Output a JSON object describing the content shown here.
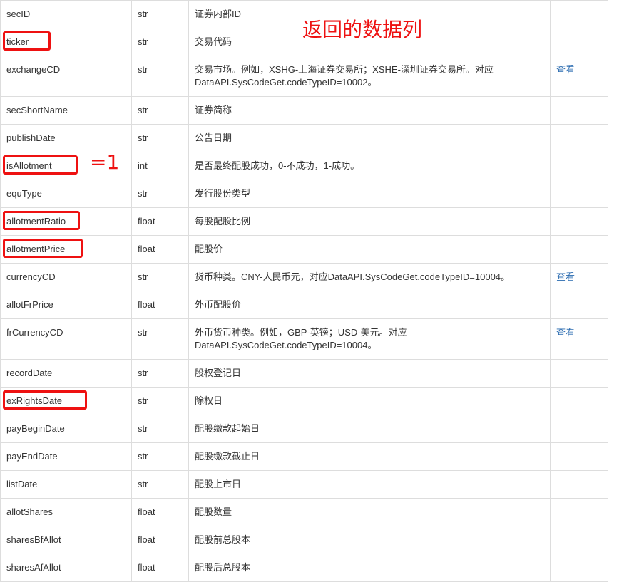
{
  "rows": [
    {
      "name": "secID",
      "type": "str",
      "desc": "证券内部ID",
      "link": "",
      "highlighted": false
    },
    {
      "name": "ticker",
      "type": "str",
      "desc": "交易代码",
      "link": "",
      "highlighted": true
    },
    {
      "name": "exchangeCD",
      "type": "str",
      "desc": "交易市场。例如，XSHG-上海证券交易所；XSHE-深圳证券交易所。对应DataAPI.SysCodeGet.codeTypeID=10002。",
      "link": "查看",
      "highlighted": false
    },
    {
      "name": "secShortName",
      "type": "str",
      "desc": "证券简称",
      "link": "",
      "highlighted": false
    },
    {
      "name": "publishDate",
      "type": "str",
      "desc": "公告日期",
      "link": "",
      "highlighted": false
    },
    {
      "name": "isAllotment",
      "type": "int",
      "desc": "是否最终配股成功，0-不成功，1-成功。",
      "link": "",
      "highlighted": true
    },
    {
      "name": "equType",
      "type": "str",
      "desc": "发行股份类型",
      "link": "",
      "highlighted": false
    },
    {
      "name": "allotmentRatio",
      "type": "float",
      "desc": "每股配股比例",
      "link": "",
      "highlighted": true
    },
    {
      "name": "allotmentPrice",
      "type": "float",
      "desc": "配股价",
      "link": "",
      "highlighted": true
    },
    {
      "name": "currencyCD",
      "type": "str",
      "desc": "货币种类。CNY-人民币元，对应DataAPI.SysCodeGet.codeTypeID=10004。",
      "link": "查看",
      "highlighted": false
    },
    {
      "name": "allotFrPrice",
      "type": "float",
      "desc": "外币配股价",
      "link": "",
      "highlighted": false
    },
    {
      "name": "frCurrencyCD",
      "type": "str",
      "desc": "外币货币种类。例如，GBP-英镑；USD-美元。对应DataAPI.SysCodeGet.codeTypeID=10004。",
      "link": "查看",
      "highlighted": false
    },
    {
      "name": "recordDate",
      "type": "str",
      "desc": "股权登记日",
      "link": "",
      "highlighted": false
    },
    {
      "name": "exRightsDate",
      "type": "str",
      "desc": "除权日",
      "link": "",
      "highlighted": true
    },
    {
      "name": "payBeginDate",
      "type": "str",
      "desc": "配股缴款起始日",
      "link": "",
      "highlighted": false
    },
    {
      "name": "payEndDate",
      "type": "str",
      "desc": "配股缴款截止日",
      "link": "",
      "highlighted": false
    },
    {
      "name": "listDate",
      "type": "str",
      "desc": "配股上市日",
      "link": "",
      "highlighted": false
    },
    {
      "name": "allotShares",
      "type": "float",
      "desc": "配股数量",
      "link": "",
      "highlighted": false
    },
    {
      "name": "sharesBfAllot",
      "type": "float",
      "desc": "配股前总股本",
      "link": "",
      "highlighted": false
    },
    {
      "name": "sharesAfAllot",
      "type": "float",
      "desc": "配股后总股本",
      "link": "",
      "highlighted": false
    }
  ],
  "annotations": {
    "title": "返回的数据列",
    "is_allotment_note": "=1"
  },
  "colors": {
    "highlight": "#ee1111",
    "link": "#2a6bb0",
    "border": "#dddddd"
  }
}
